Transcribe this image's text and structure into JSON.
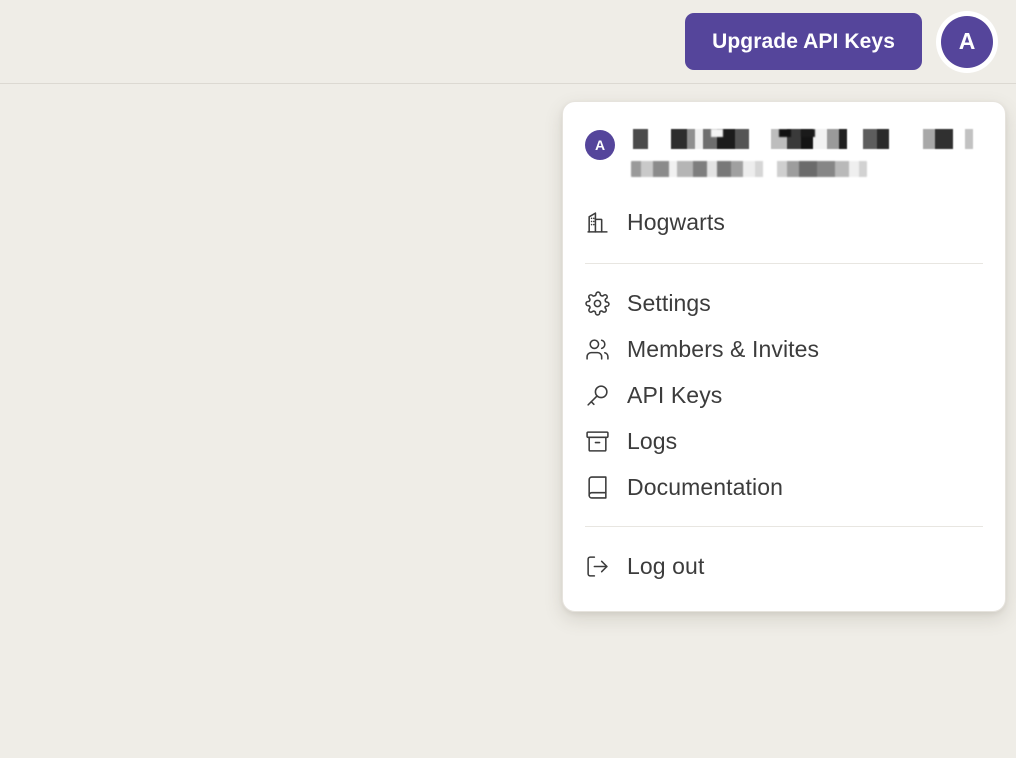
{
  "theme": {
    "background": "#EFEDE7",
    "accent_purple": "#55459B",
    "panel_background": "#FFFFFF",
    "text_color": "#3C3C3C",
    "divider": "#E8E6E1"
  },
  "header": {
    "upgrade_button_label": "Upgrade API Keys",
    "avatar_initial": "A"
  },
  "account_menu": {
    "account": {
      "avatar_initial": "A",
      "name": "[redacted]",
      "email": "[redacted]"
    },
    "organization": {
      "label": "Hogwarts",
      "icon": "building-icon"
    },
    "items": [
      {
        "label": "Settings",
        "icon": "gear-icon"
      },
      {
        "label": "Members & Invites",
        "icon": "users-icon"
      },
      {
        "label": "API Keys",
        "icon": "key-icon"
      },
      {
        "label": "Logs",
        "icon": "archive-icon"
      },
      {
        "label": "Documentation",
        "icon": "book-icon"
      }
    ],
    "logout": {
      "label": "Log out",
      "icon": "logout-icon"
    }
  }
}
